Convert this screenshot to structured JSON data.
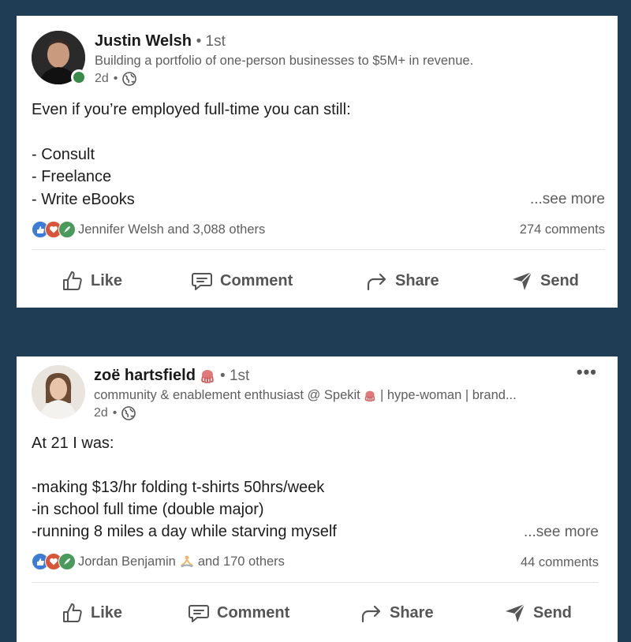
{
  "posts": [
    {
      "author": "Justin Welsh",
      "degree": "1st",
      "headline": "Building a portfolio of one-person businesses to $5M+ in revenue.",
      "time": "2d",
      "body": [
        "Even if you’re employed full-time you can still:",
        "",
        "- Consult",
        "- Freelance",
        "- Write eBooks"
      ],
      "see_more": "...see more",
      "reactors": "Jennifer Welsh and 3,088 others",
      "comments": "274 comments"
    },
    {
      "author": "zoë hartsfield",
      "degree": "1st",
      "headline_a": "community & enablement enthusiast @ Spekit",
      "headline_b": "| hype-woman | brand...",
      "time": "2d",
      "body": [
        "At 21 I was:",
        "",
        "-making $13/hr folding t-shirts 50hrs/week",
        "-in school full time (double major)",
        "-running 8 miles a day while starving myself"
      ],
      "see_more": "...see more",
      "reactor_name": "Jordan Benjamin",
      "reactor_rest": "and 170 others",
      "comments": "44 comments"
    }
  ],
  "actions": {
    "like": "Like",
    "comment": "Comment",
    "share": "Share",
    "send": "Send"
  },
  "separator": "•",
  "more_menu": "•••",
  "icons": [
    "globe-icon",
    "like-icon",
    "comment-icon",
    "share-icon",
    "send-icon",
    "octopus-emoji-icon",
    "meditation-emoji-icon"
  ],
  "colors": {
    "background": "#1f3d55",
    "card": "#ffffff",
    "online": "#3a8a4a",
    "like_blue": "#3c7bd6",
    "love_red": "#d9553a",
    "support_green": "#4a9a5c"
  }
}
